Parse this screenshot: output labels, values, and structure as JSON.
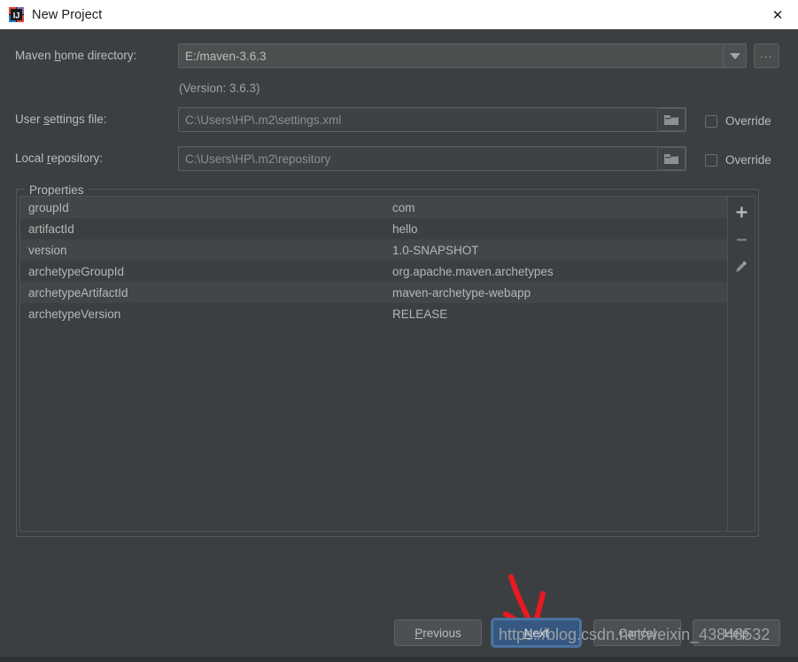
{
  "window": {
    "title": "New Project",
    "app_icon": "intellij-idea-icon",
    "close_label": "✕"
  },
  "form": {
    "maven_home": {
      "label_prefix": "Maven ",
      "label_mnemonic": "h",
      "label_suffix": "ome directory:",
      "value": "E:/maven-3.6.3",
      "dropdown_icon": "chevron-down-icon",
      "browse_label": "...",
      "version_note": "(Version: 3.6.3)"
    },
    "user_settings": {
      "label_prefix": "User ",
      "label_mnemonic": "s",
      "label_suffix": "ettings file:",
      "value": "C:\\Users\\HP\\.m2\\settings.xml",
      "browse_icon": "folder-icon",
      "override_label": "Override",
      "override_checked": false
    },
    "local_repository": {
      "label_prefix": "Local ",
      "label_mnemonic": "r",
      "label_suffix": "epository:",
      "value": "C:\\Users\\HP\\.m2\\repository",
      "browse_icon": "folder-icon",
      "override_label": "Override",
      "override_checked": false
    }
  },
  "properties": {
    "legend": "Properties",
    "rows": [
      {
        "key": "groupId",
        "value": "com"
      },
      {
        "key": "artifactId",
        "value": "hello"
      },
      {
        "key": "version",
        "value": "1.0-SNAPSHOT"
      },
      {
        "key": "archetypeGroupId",
        "value": "org.apache.maven.archetypes"
      },
      {
        "key": "archetypeArtifactId",
        "value": "maven-archetype-webapp"
      },
      {
        "key": "archetypeVersion",
        "value": "RELEASE"
      }
    ],
    "toolbar": {
      "add_icon": "plus-icon",
      "remove_icon": "minus-icon",
      "edit_icon": "pencil-icon"
    }
  },
  "buttons": {
    "previous": {
      "prefix": "",
      "mnemonic": "P",
      "suffix": "revious"
    },
    "next": {
      "prefix": "",
      "mnemonic": "N",
      "suffix": "ext"
    },
    "cancel": {
      "label": "Cancel"
    },
    "help": {
      "label": "Help"
    }
  },
  "annotation": {
    "arrow_color": "#e8191f",
    "arrow_name": "red-down-arrow"
  },
  "watermark": {
    "text": "https://blog.csdn.net/weixin_43848532"
  },
  "colors": {
    "window_bg": "#3c3f41",
    "titlebar_bg": "#ffffff",
    "primary_button": "#365880",
    "row_stripe": "#434648",
    "text": "#bbbbbb"
  }
}
